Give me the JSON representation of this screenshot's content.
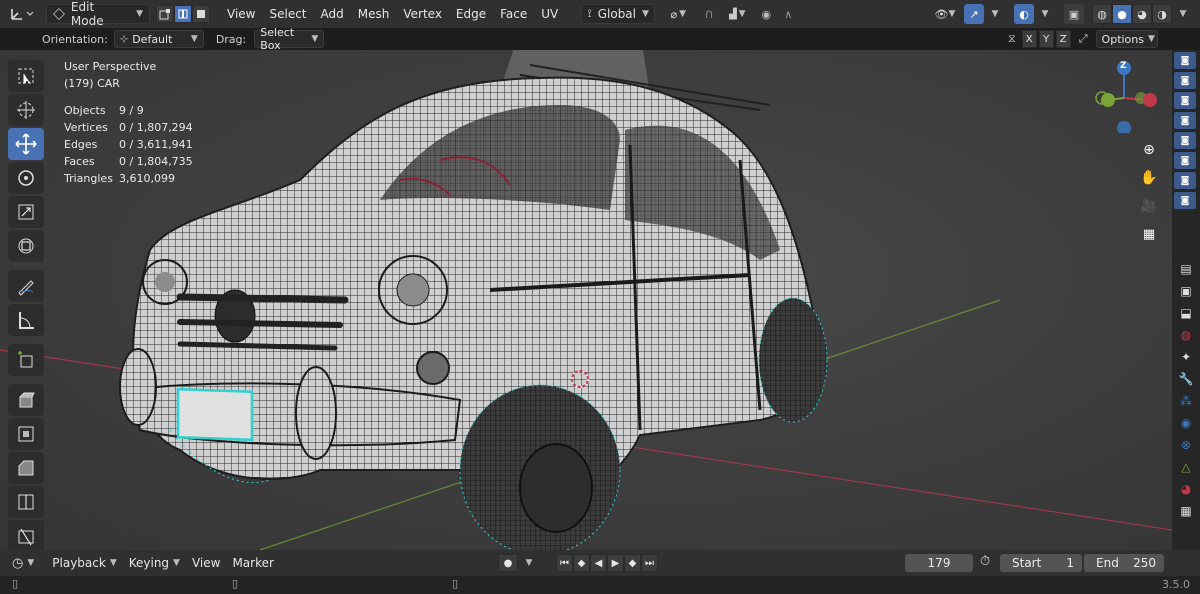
{
  "header": {
    "mode_label": "Edit Mode",
    "menus": [
      "View",
      "Select",
      "Add",
      "Mesh",
      "Vertex",
      "Edge",
      "Face",
      "UV"
    ],
    "orientation_label": "Global"
  },
  "tool_header": {
    "orientation_label": "Orientation:",
    "orientation_value": "Default",
    "drag_label": "Drag:",
    "drag_value": "Select Box",
    "axis_x": "X",
    "axis_y": "Y",
    "axis_z": "Z",
    "options_label": "Options"
  },
  "viewport": {
    "perspective": "User Perspective",
    "object_name": "(179) CAR",
    "stats": [
      {
        "key": "Objects",
        "value": "9 / 9"
      },
      {
        "key": "Vertices",
        "value": "0 / 1,807,294"
      },
      {
        "key": "Edges",
        "value": "0 / 3,611,941"
      },
      {
        "key": "Faces",
        "value": "0 / 1,804,735"
      },
      {
        "key": "Triangles",
        "value": "3,610,099"
      }
    ],
    "gizmo_z": "Z"
  },
  "timeline": {
    "playback": "Playback",
    "keying": "Keying",
    "view": "View",
    "marker": "Marker",
    "current_frame": "179",
    "start_label": "Start",
    "start_value": "1",
    "end_label": "End",
    "end_value": "250"
  },
  "status": {
    "version": "3.5.0"
  },
  "colors": {
    "accent": "#4772b3",
    "header_bg": "#303030",
    "viewport_bg": "#3f3f3f",
    "selection": "#2fd0d0",
    "axis_x": "#c0394b",
    "axis_y": "#7aa537",
    "axis_z": "#3a78c6"
  }
}
